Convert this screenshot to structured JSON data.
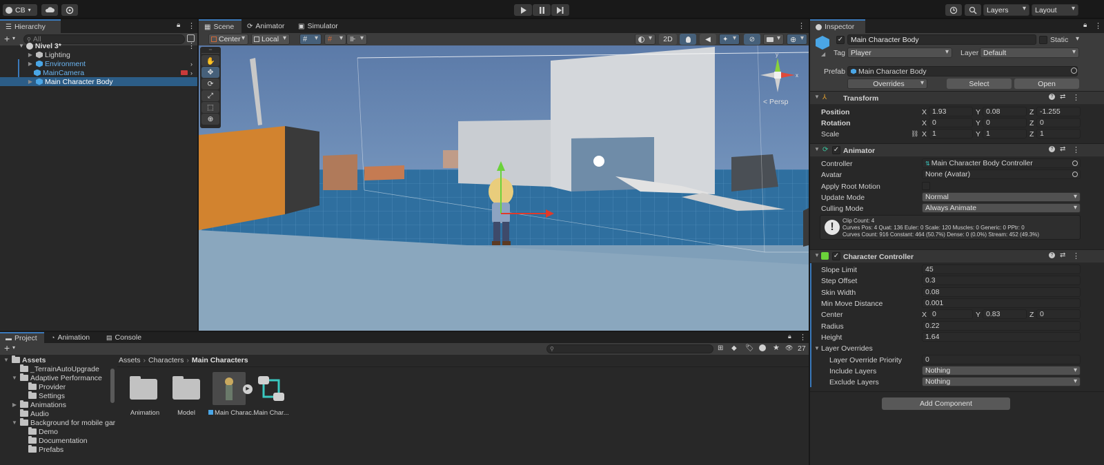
{
  "toolbar": {
    "account": "CB",
    "layers": "Layers",
    "layout": "Layout"
  },
  "hierarchy": {
    "tab": "Hierarchy",
    "search_placeholder": "All",
    "scene": "Nivel 3*",
    "items": [
      "Lighting",
      "Environment",
      "MainCamera",
      "Main Character Body"
    ]
  },
  "scene_view": {
    "tabs": [
      "Scene",
      "Animator",
      "Simulator"
    ],
    "pivot": "Center",
    "space": "Local",
    "mode_2d": "2D",
    "persp": "< Persp"
  },
  "project": {
    "tabs": [
      "Project",
      "Animation",
      "Console"
    ],
    "count": "27",
    "breadcrumb": [
      "Assets",
      "Characters",
      "Main Characters"
    ],
    "tree": [
      {
        "label": "Assets",
        "level": 0,
        "bold": true
      },
      {
        "label": "_TerrainAutoUpgrade",
        "level": 1
      },
      {
        "label": "Adaptive Performance",
        "level": 1
      },
      {
        "label": "Provider",
        "level": 2
      },
      {
        "label": "Settings",
        "level": 2
      },
      {
        "label": "Animations",
        "level": 1
      },
      {
        "label": "Audio",
        "level": 1
      },
      {
        "label": "Background for mobile gar",
        "level": 1
      },
      {
        "label": "Demo",
        "level": 2
      },
      {
        "label": "Documentation",
        "level": 2
      },
      {
        "label": "Prefabs",
        "level": 2
      }
    ],
    "assets": [
      "Animation",
      "Model",
      "Main Charac...",
      "Main Char..."
    ]
  },
  "inspector": {
    "tab": "Inspector",
    "object_name": "Main Character Body",
    "static_label": "Static",
    "tag_label": "Tag",
    "tag_value": "Player",
    "layer_label": "Layer",
    "layer_value": "Default",
    "prefab_label": "Prefab",
    "prefab_value": "Main Character Body",
    "overrides": "Overrides",
    "select": "Select",
    "open": "Open",
    "transform": {
      "title": "Transform",
      "position_label": "Position",
      "rotation_label": "Rotation",
      "scale_label": "Scale",
      "position": [
        "1.93",
        "0.08",
        "-1.255"
      ],
      "rotation": [
        "0",
        "0",
        "0"
      ],
      "scale": [
        "1",
        "1",
        "1"
      ]
    },
    "animator": {
      "title": "Animator",
      "controller_label": "Controller",
      "controller_value": "Main Character Body Controller",
      "avatar_label": "Avatar",
      "avatar_value": "None (Avatar)",
      "apply_root_label": "Apply Root Motion",
      "update_mode_label": "Update Mode",
      "update_mode_value": "Normal",
      "culling_label": "Culling Mode",
      "culling_value": "Always Animate",
      "info_1": "Clip Count: 4",
      "info_2": "Curves Pos: 4 Quat: 136 Euler: 0 Scale: 120 Muscles: 0 Generic: 0 PPtr: 0",
      "info_3": "Curves Count: 916 Constant: 464 (50.7%) Dense: 0 (0.0%) Stream: 452 (49.3%)"
    },
    "cc": {
      "title": "Character Controller",
      "slope_label": "Slope Limit",
      "slope": "45",
      "step_label": "Step Offset",
      "step": "0.3",
      "skin_label": "Skin Width",
      "skin": "0.08",
      "minmove_label": "Min Move Distance",
      "minmove": "0.001",
      "center_label": "Center",
      "center": [
        "0",
        "0.83",
        "0"
      ],
      "radius_label": "Radius",
      "radius": "0.22",
      "height_label": "Height",
      "height": "1.64",
      "layer_overrides_label": "Layer Overrides",
      "priority_label": "Layer Override Priority",
      "priority": "0",
      "include_label": "Include Layers",
      "include": "Nothing",
      "exclude_label": "Exclude Layers",
      "exclude": "Nothing"
    },
    "add_component": "Add Component"
  },
  "axis": {
    "x": "X",
    "y": "Y",
    "z": "Z"
  }
}
